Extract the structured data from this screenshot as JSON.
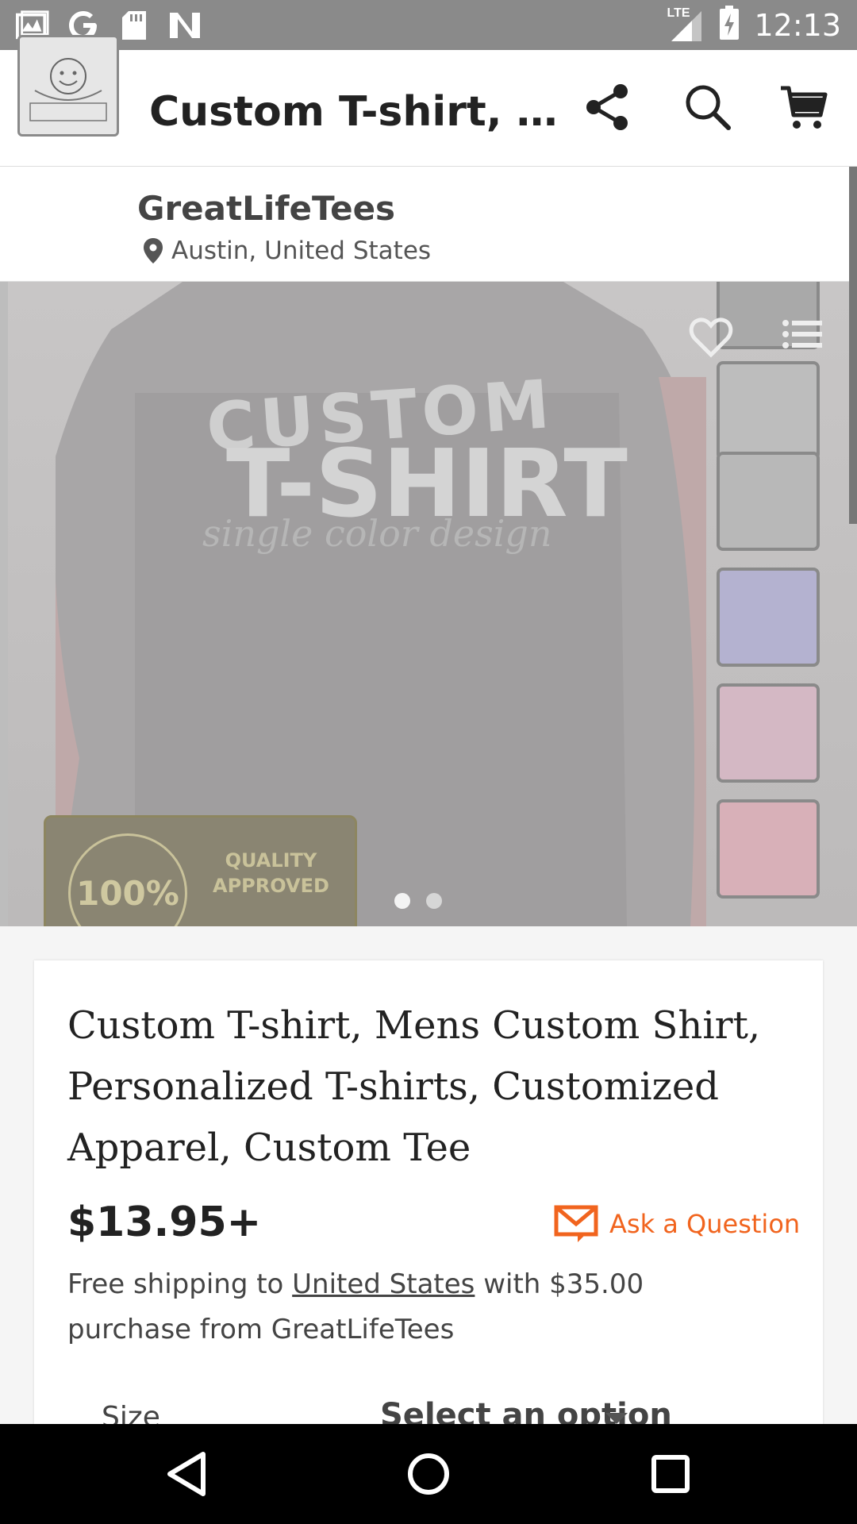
{
  "status_bar": {
    "time": "12:13",
    "network": "LTE",
    "left_icons": [
      "gallery-icon",
      "google-icon",
      "sd-card-icon",
      "n-icon"
    ],
    "right_icons": [
      "signal-icon",
      "battery-charging-icon"
    ]
  },
  "app_bar": {
    "title": "Custom T-shirt, M...",
    "icons": [
      "menu-icon",
      "share-icon",
      "search-icon",
      "cart-icon"
    ],
    "accent_color": "#f1641e"
  },
  "shop": {
    "name": "GreatLifeTees",
    "location": "Austin, United States",
    "logo_icon": "shop-logo"
  },
  "hero": {
    "image_text": {
      "line1": "CUSTOM",
      "line2": "T-SHIRT",
      "line3": "single color design"
    },
    "badge": {
      "seal_text": "100%",
      "line1": "QUALITY",
      "line2": "APPROVED"
    },
    "thumbnail_colors": [
      "#bdbdbd",
      "#b8b8b8",
      "#b4b2d0",
      "#d4b8c4",
      "#d8b0b8"
    ],
    "favorite_icon": "heart-icon",
    "list_icon": "list-icon",
    "page_count": 2,
    "active_page": 1
  },
  "product": {
    "title": "Custom T-shirt, Mens Custom Shirt, Personalized T-shirts, Customized Apparel, Custom Tee",
    "price": "$13.95+",
    "ask_label": "Ask a Question",
    "shipping_prefix": "Free shipping to ",
    "shipping_link": "United States",
    "shipping_suffix": " with $35.00 purchase from GreatLifeTees",
    "size_label": "Size",
    "size_placeholder": "Select an option"
  },
  "nav_bar": {
    "buttons": [
      "back-icon",
      "home-icon",
      "recents-icon"
    ]
  }
}
